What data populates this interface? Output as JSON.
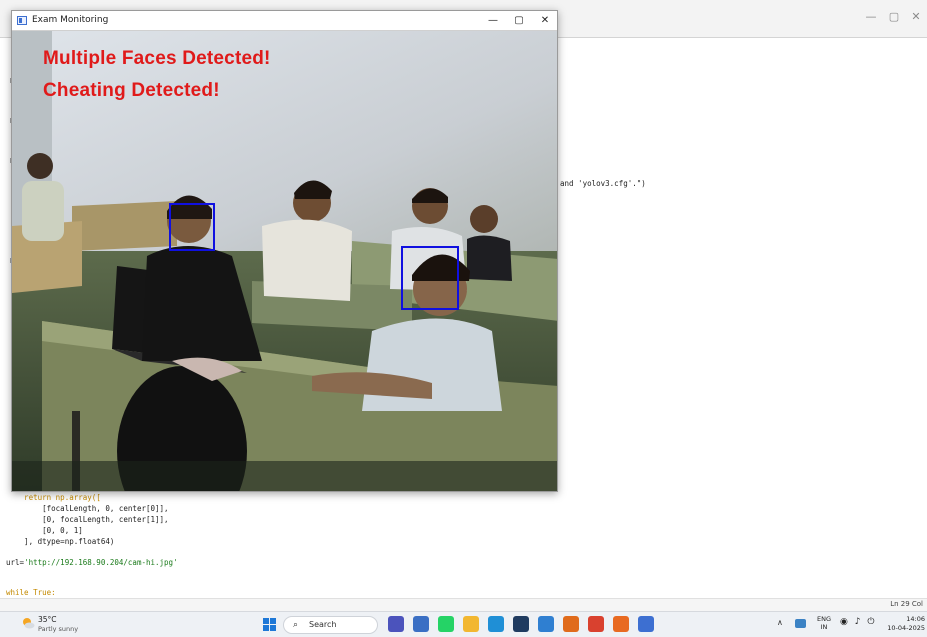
{
  "editor": {
    "controls": {
      "minimize": "—",
      "maximize": "▢",
      "close": "✕"
    },
    "code_lines": {
      "yolo_fragment": "and 'yolov3.cfg'.\")",
      "return_array": "    return np.array([",
      "row_1": "        [focalLength, 0, center[0]],",
      "row_2": "        [0, focalLength, center[1]],",
      "row_3": "        [0, 0, 1]",
      "dtype_line": "    ], dtype=np.float64)",
      "url_prefix": "url=",
      "url_value": "'http://192.168.90.204/cam-hi.jpg'",
      "while_line": "while True:"
    },
    "status_position": "Ln 29  Col"
  },
  "monitor": {
    "title": "Exam Monitoring",
    "controls": {
      "minimize": "—",
      "maximize": "▢",
      "close": "✕"
    },
    "alerts": [
      "Multiple Faces Detected!",
      "Cheating Detected!"
    ],
    "face_box_color": "#1010e0",
    "alert_color": "#e01a1a"
  },
  "taskbar": {
    "weather": {
      "temperature": "35°C",
      "condition": "Partly sunny"
    },
    "search_label": "Search",
    "apps": [
      {
        "name": "teams-app",
        "color": "#4b53bc"
      },
      {
        "name": "files-app",
        "color": "#3a6fc4"
      },
      {
        "name": "whatsapp-app",
        "color": "#25d366"
      },
      {
        "name": "file-explorer-app",
        "color": "#f2b731"
      },
      {
        "name": "edge-app",
        "color": "#1f8fd6"
      },
      {
        "name": "terminal-app",
        "color": "#1f3b60"
      },
      {
        "name": "vscode-app",
        "color": "#2f7fd1"
      },
      {
        "name": "store-app",
        "color": "#e06b1c"
      },
      {
        "name": "chrome-app",
        "color": "#d9412f"
      },
      {
        "name": "firefox-app",
        "color": "#e86a22"
      },
      {
        "name": "notepad-app",
        "color": "#3d6fd1"
      }
    ],
    "language": {
      "line1": "ENG",
      "line2": "IN"
    },
    "tray_icons": "◉ ♪ ⏻",
    "clock": {
      "time": "14:06",
      "date": "10-04-2025"
    }
  }
}
